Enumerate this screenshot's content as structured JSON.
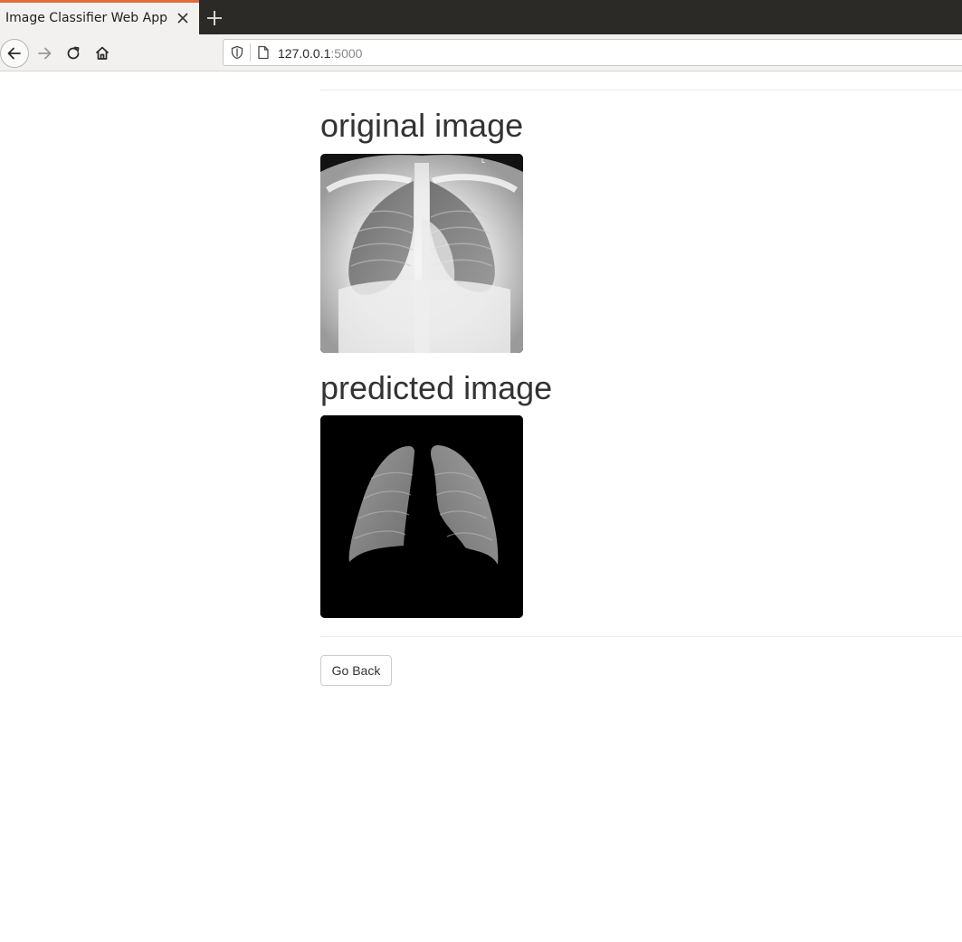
{
  "browser": {
    "tab_title": "Image Classifier Web App",
    "url_host": "127.0.0.1",
    "url_port": ":5000",
    "icons": {
      "tab_close": "close-icon",
      "new_tab": "plus-icon",
      "back": "arrow-left-icon",
      "forward": "arrow-right-icon",
      "reload": "reload-icon",
      "home": "home-icon",
      "shield": "shield-icon",
      "page": "page-icon"
    }
  },
  "page": {
    "original_heading": "original image",
    "predicted_heading": "predicted image",
    "go_back_label": "Go Back"
  },
  "colors": {
    "tab_accent": "#e26a3c",
    "tabstrip_bg": "#2b2a27",
    "toolbar_bg": "#f2f1f0",
    "heading_text": "#333333"
  }
}
